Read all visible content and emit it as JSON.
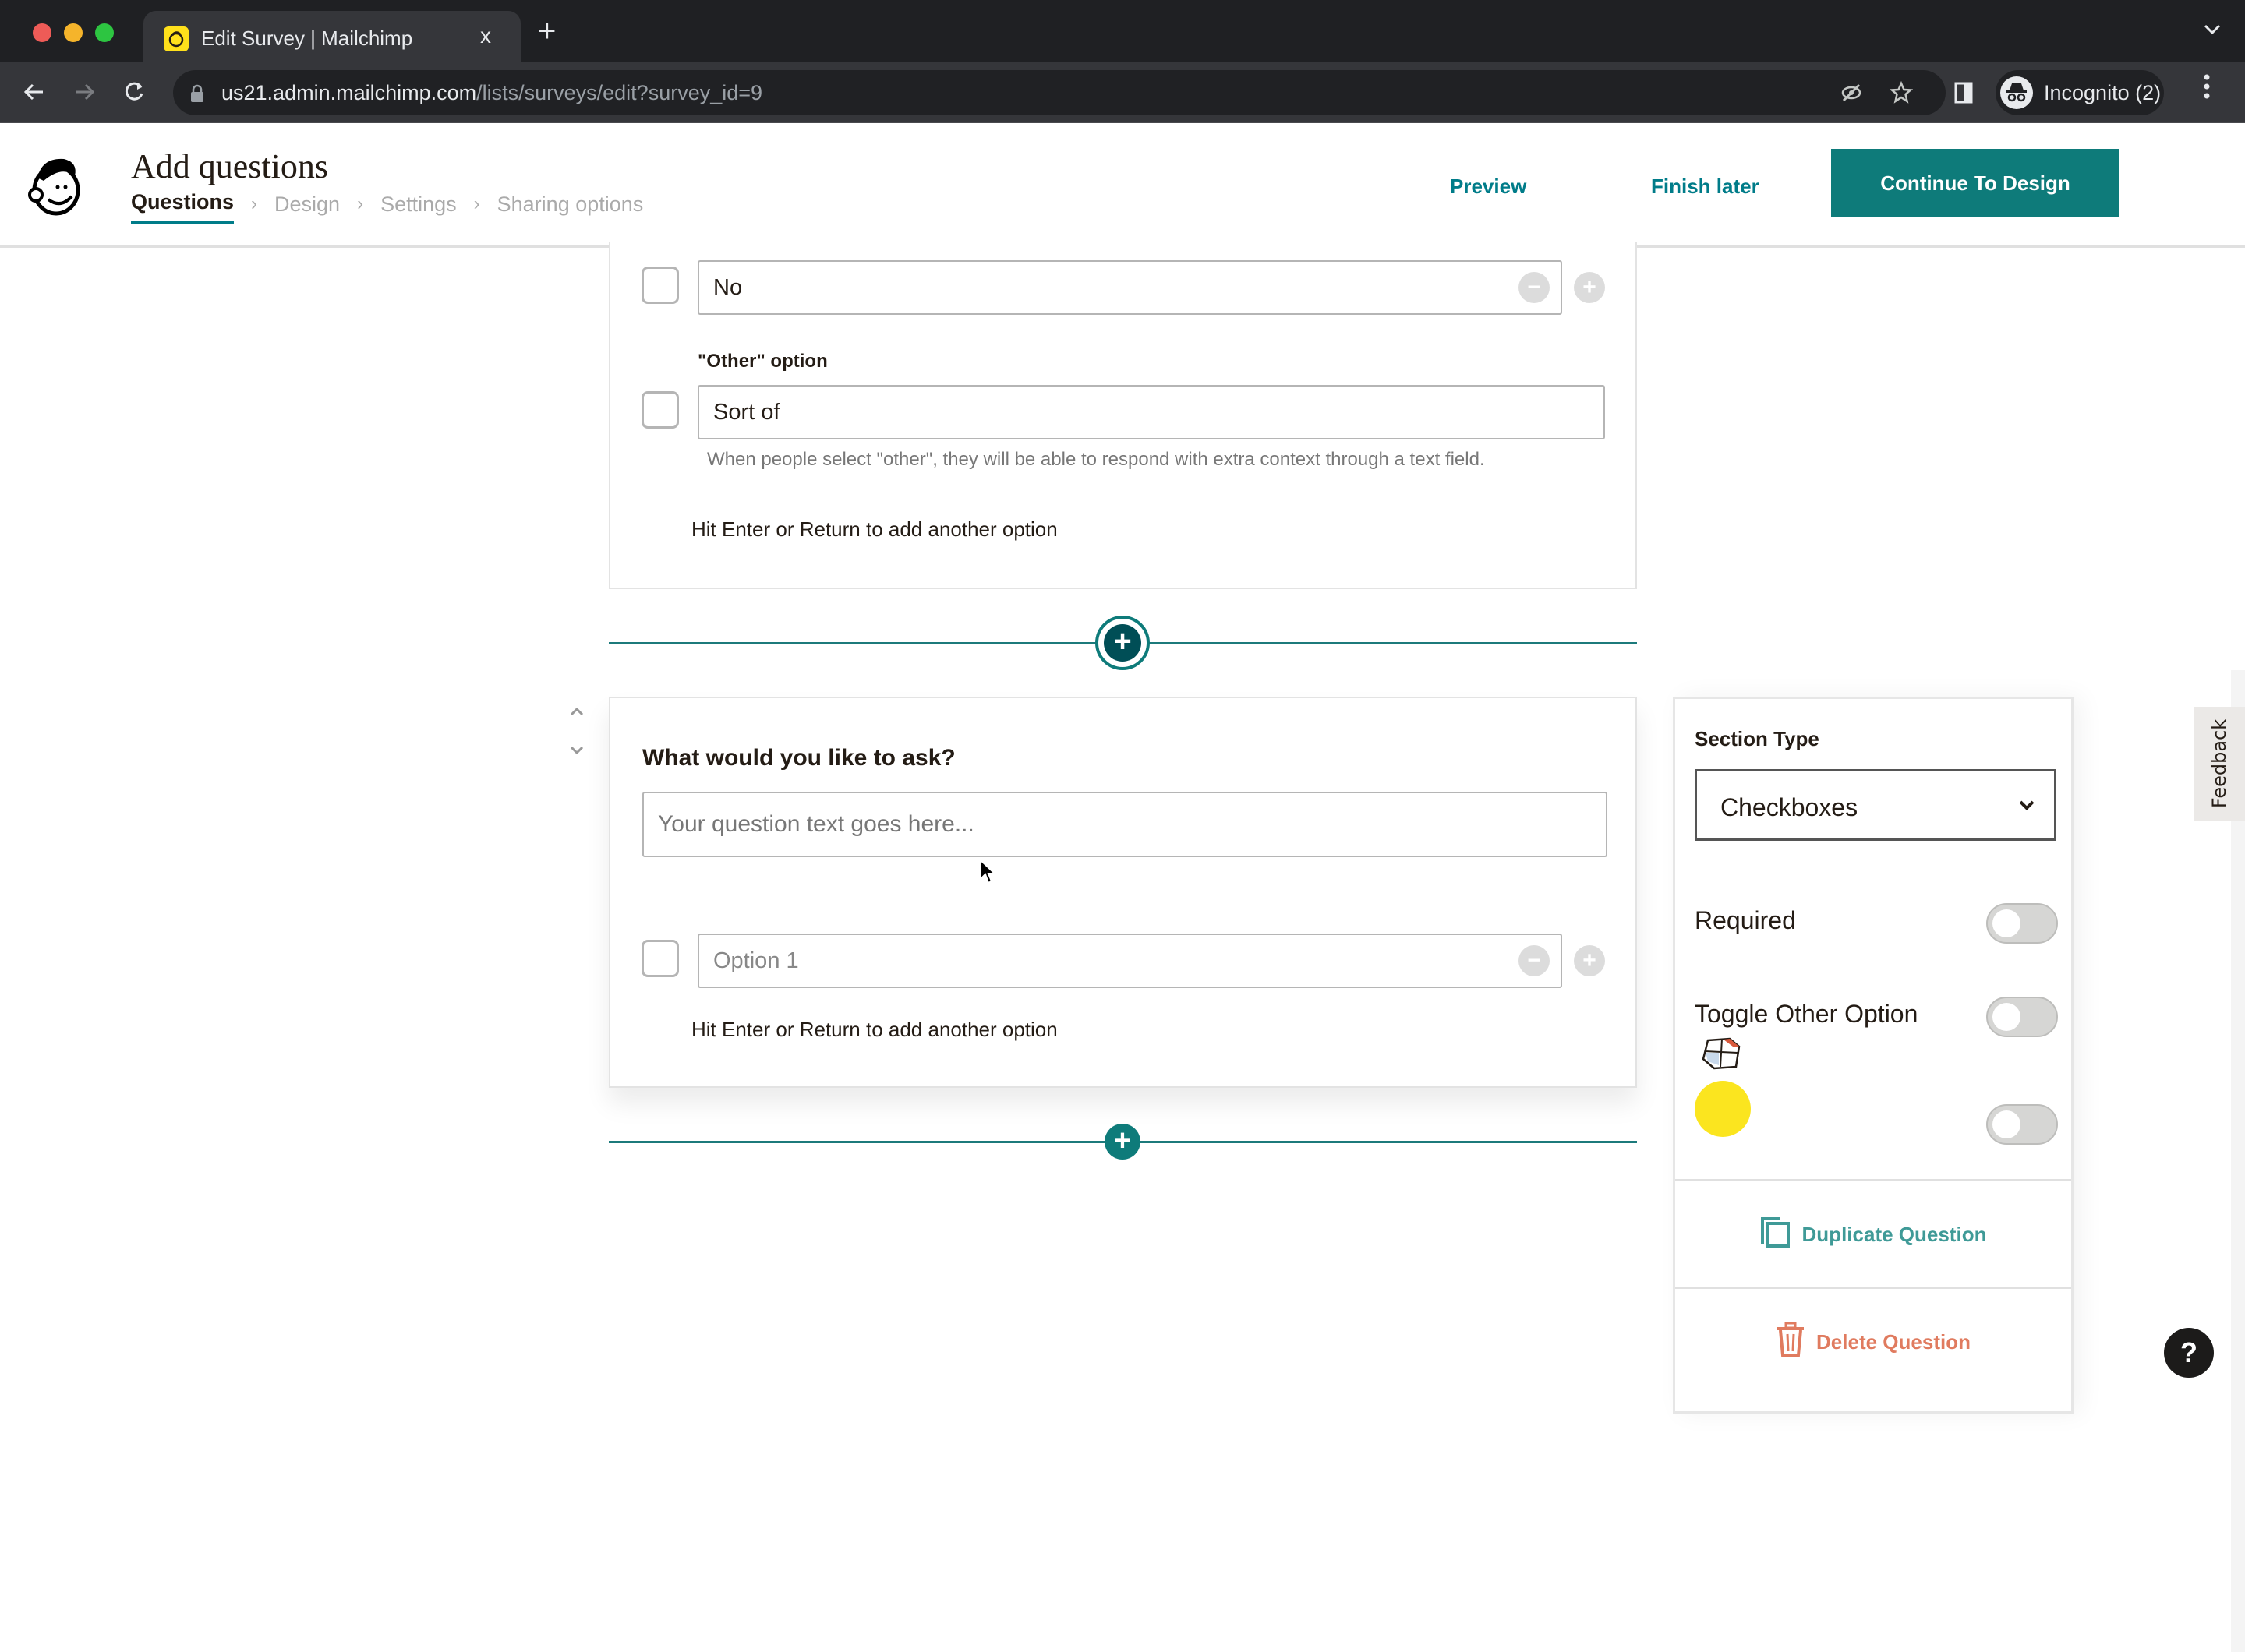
{
  "browser": {
    "tab_title": "Edit Survey | Mailchimp",
    "tab_close": "x",
    "new_tab": "+",
    "url_host": "us21.admin.mailchimp.com",
    "url_path": "/lists/surveys/edit?survey_id=9",
    "profile_label": "Incognito (2)"
  },
  "header": {
    "title": "Add questions",
    "steps": [
      {
        "label": "Questions",
        "active": true
      },
      {
        "label": "Design",
        "active": false
      },
      {
        "label": "Settings",
        "active": false
      },
      {
        "label": "Sharing options",
        "active": false
      }
    ],
    "step_separator": "›",
    "preview_label": "Preview",
    "finish_later_label": "Finish later",
    "continue_label": "Continue To Design"
  },
  "question_previous": {
    "options": [
      {
        "value": "No"
      }
    ],
    "other_option": {
      "label": "\"Other\" option",
      "value": "Sort of",
      "helper": "When people select \"other\", they will be able to respond with extra context through a text field."
    },
    "hint": "Hit Enter or Return to add another option"
  },
  "question_current": {
    "label": "What would you like to ask?",
    "question_placeholder": "Your question text goes here...",
    "options": [
      {
        "placeholder": "Option 1"
      }
    ],
    "hint": "Hit Enter or Return to add another option"
  },
  "controls": {
    "remove_symbol": "−",
    "add_symbol": "+",
    "move_up": "⌃",
    "move_down": "⌄"
  },
  "panel": {
    "section_type_label": "Section Type",
    "section_type_value": "Checkboxes",
    "toggles": [
      {
        "label": "Required",
        "on": false
      },
      {
        "label": "Toggle Other Option",
        "on": false
      },
      {
        "label": "",
        "on": false
      }
    ],
    "duplicate_label": "Duplicate Question",
    "delete_label": "Delete Question"
  },
  "feedback_label": "Feedback",
  "help_label": "?",
  "colors": {
    "brand_teal": "#0e7b7a",
    "danger": "#e07b5f",
    "mailchimp_yellow": "#ffe01b"
  }
}
